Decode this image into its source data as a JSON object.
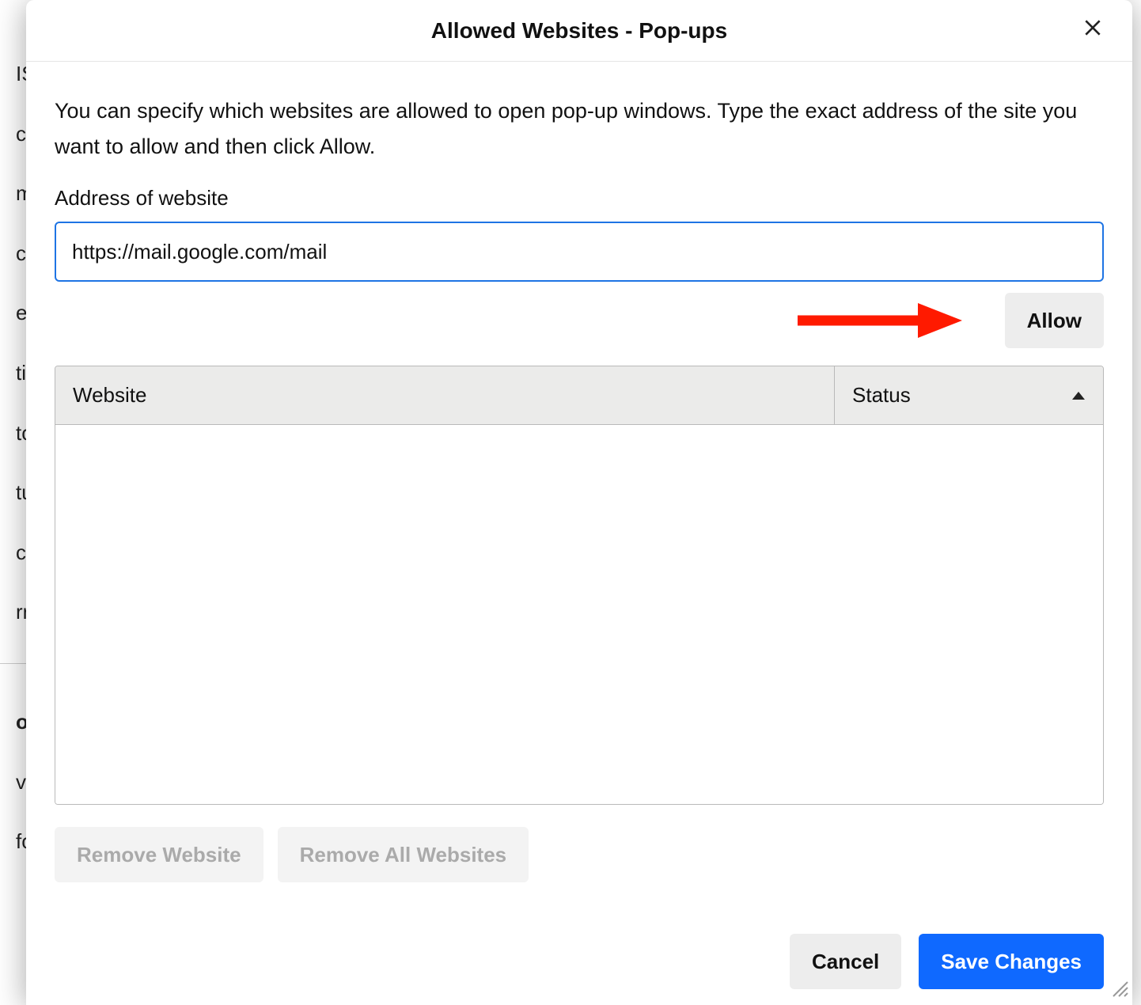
{
  "modal": {
    "title": "Allowed Websites - Pop-ups",
    "description": "You can specify which websites are allowed to open pop-up windows. Type the exact address of the site you want to allow and then click Allow.",
    "address": {
      "label": "Address of website",
      "value": "https://mail.google.com/mail"
    },
    "allow_button": "Allow",
    "table": {
      "col_website": "Website",
      "col_status": "Status",
      "rows": []
    },
    "remove_website_button": "Remove Website",
    "remove_all_button": "Remove All Websites",
    "cancel_button": "Cancel",
    "save_button": "Save Changes"
  },
  "background": {
    "fragments": [
      "IS",
      "ca",
      "m",
      "cr",
      "ea",
      "ti",
      "to",
      "tu",
      "ck",
      "rr",
      "o",
      "ve"
    ],
    "bottom_line": "for evervone  We always ask permission before receiving personal information"
  }
}
